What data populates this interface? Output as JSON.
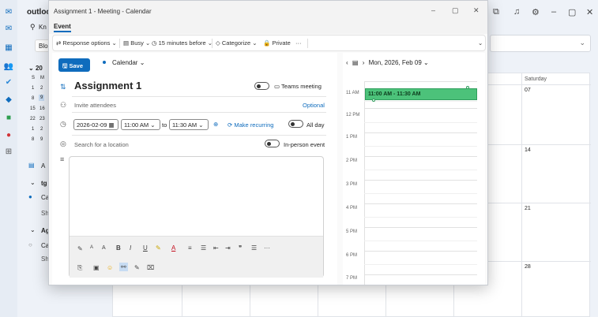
{
  "background": {
    "app_title": "outlook",
    "search_text": "Kn",
    "dropdown_text": "Blo",
    "mini_cal": {
      "month_label": "20",
      "rows": [
        [
          "S",
          "M"
        ],
        [
          "1",
          "2"
        ],
        [
          "8",
          "9"
        ],
        [
          "15",
          "16"
        ],
        [
          "22",
          "23"
        ],
        [
          "1",
          "2"
        ],
        [
          "8",
          "9"
        ]
      ]
    },
    "sidebar": {
      "add_label": "A",
      "group1": "tg",
      "item1": "Ca",
      "show1": "Sh",
      "group2": "Ag",
      "item2": "Ca",
      "show2": "Sh"
    },
    "calendar": {
      "saturday_header": "Saturday",
      "dates": [
        "07",
        "14",
        "21",
        "28"
      ]
    }
  },
  "dialog": {
    "window_title": "Assignment 1 - Meeting - Calendar",
    "tab_event": "Event",
    "ribbon": {
      "response_options": "Response options",
      "busy": "Busy",
      "reminder": "15 minutes before",
      "categorize": "Categorize",
      "private": "Private",
      "more": "···"
    },
    "form": {
      "save_label": "Save",
      "calendar_label": "Calendar",
      "title": "Assignment 1",
      "teams_meeting_label": "Teams meeting",
      "invite_placeholder": "Invite attendees",
      "optional_label": "Optional",
      "start_date": "2026-02-09",
      "start_time": "11:00 AM",
      "to_label": "to",
      "end_time": "11:30 AM",
      "make_recurring_label": "Make recurring",
      "all_day_label": "All day",
      "location_placeholder": "Search for a location",
      "in_person_label": "In-person event"
    },
    "timeline": {
      "date_label": "Mon, 2026, Feb 09",
      "hours": [
        "11 AM",
        "12 PM",
        "1 PM",
        "2 PM",
        "3 PM",
        "4 PM",
        "5 PM",
        "6 PM",
        "7 PM"
      ],
      "event_text": "11:00 AM - 11:30 AM",
      "event_color": "#4cc27a"
    }
  }
}
